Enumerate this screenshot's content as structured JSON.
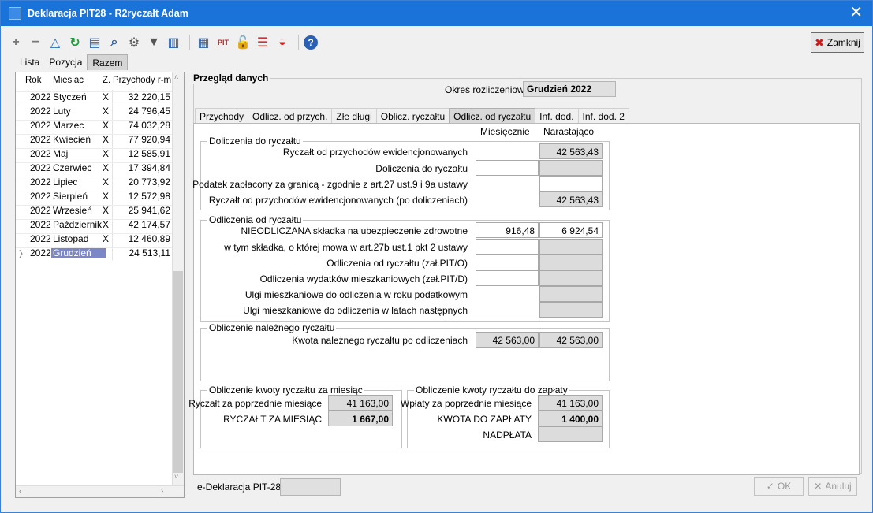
{
  "window": {
    "title": "Deklaracja PIT28 - R2ryczałt Adam"
  },
  "toolbar": {
    "icons": [
      "plus-icon",
      "minus-icon",
      "triangle-icon",
      "refresh-icon",
      "print-icon",
      "search-icon",
      "settings-icon",
      "filter-icon",
      "columns-icon",
      "grid-icon",
      "pit-icon",
      "unlock-icon",
      "stack-icon",
      "send-icon",
      "help-icon"
    ],
    "close_label": "Zamknij"
  },
  "subtabs": [
    {
      "label": "Lista"
    },
    {
      "label": "Pozycja"
    },
    {
      "label": "Razem"
    }
  ],
  "list": {
    "headers": {
      "rok": "Rok",
      "miesiac": "Miesiac",
      "z": "Z.",
      "przychody": "Przychody r-m"
    },
    "rows": [
      {
        "rok": "2022",
        "miesiac": "Styczeń",
        "z": "X",
        "przychody": "32 220,15"
      },
      {
        "rok": "2022",
        "miesiac": "Luty",
        "z": "X",
        "przychody": "24 796,45"
      },
      {
        "rok": "2022",
        "miesiac": "Marzec",
        "z": "X",
        "przychody": "74 032,28"
      },
      {
        "rok": "2022",
        "miesiac": "Kwiecień",
        "z": "X",
        "przychody": "77 920,94"
      },
      {
        "rok": "2022",
        "miesiac": "Maj",
        "z": "X",
        "przychody": "12 585,91"
      },
      {
        "rok": "2022",
        "miesiac": "Czerwiec",
        "z": "X",
        "przychody": "17 394,84"
      },
      {
        "rok": "2022",
        "miesiac": "Lipiec",
        "z": "X",
        "przychody": "20 773,92"
      },
      {
        "rok": "2022",
        "miesiac": "Sierpień",
        "z": "X",
        "przychody": "12 572,98"
      },
      {
        "rok": "2022",
        "miesiac": "Wrzesień",
        "z": "X",
        "przychody": "25 941,62"
      },
      {
        "rok": "2022",
        "miesiac": "Październik",
        "z": "X",
        "przychody": "42 174,57"
      },
      {
        "rok": "2022",
        "miesiac": "Listopad",
        "z": "X",
        "przychody": "12 460,89"
      },
      {
        "rok": "2022",
        "miesiac": "Grudzień",
        "z": "",
        "przychody": "24 513,11"
      }
    ]
  },
  "main": {
    "group_title": "Przegląd danych",
    "okres_label": "Okres rozliczeniowy",
    "okres_value": "Grudzień 2022",
    "tabs": [
      {
        "label": "Przychody"
      },
      {
        "label": "Odlicz. od przych."
      },
      {
        "label": "Złe długi"
      },
      {
        "label": "Oblicz. ryczałtu"
      },
      {
        "label": "Odlicz. od ryczałtu"
      },
      {
        "label": "Inf. dod."
      },
      {
        "label": "Inf. dod. 2"
      }
    ],
    "col_monthly": "Miesięcznie",
    "col_cumulative": "Narastająco",
    "sec1": {
      "title": "Doliczenia do ryczałtu",
      "r1_label": "Ryczałt od przychodów ewidencjonowanych",
      "r1_cum": "42 563,43",
      "r2_label": "Doliczenia do ryczałtu",
      "r3_label": "Podatek zapłacony za granicą - zgodnie z art.27 ust.9 i 9a ustawy",
      "r4_label": "Ryczałt od przychodów ewidencjonowanych (po doliczeniach)",
      "r4_cum": "42 563,43"
    },
    "sec2": {
      "title": "Odliczenia od ryczałtu",
      "r1_label": "NIEODLICZANA składka na ubezpieczenie zdrowotne",
      "r1_mon": "916,48",
      "r1_cum": "6 924,54",
      "r2_label": "w tym składka, o której mowa w art.27b ust.1 pkt 2 ustawy",
      "r3_label": "Odliczenia od ryczałtu (zał.PIT/O)",
      "r4_label": "Odliczenia wydatków mieszkaniowych (zał.PIT/D)",
      "r5_label": "Ulgi mieszkaniowe do odliczenia w roku podatkowym",
      "r6_label": "Ulgi mieszkaniowe do odliczenia w latach następnych"
    },
    "sec3": {
      "title": "Obliczenie należnego ryczałtu",
      "r1_label": "Kwota należnego ryczałtu po odliczeniach",
      "r1_mon": "42 563,00",
      "r1_cum": "42 563,00"
    },
    "sec4": {
      "title": "Obliczenie kwoty ryczałtu za miesiąc",
      "r1_label": "Ryczałt za poprzednie miesiące",
      "r1_val": "41 163,00",
      "r2_label": "RYCZAŁT ZA MIESIĄC",
      "r2_val": "1 667,00"
    },
    "sec5": {
      "title": "Obliczenie kwoty ryczałtu do zapłaty",
      "r1_label": "Wpłaty za poprzednie miesiące",
      "r1_val": "41 163,00",
      "r2_label": "KWOTA DO ZAPŁATY",
      "r2_val": "1 400,00",
      "r3_label": "NADPŁATA"
    }
  },
  "footer": {
    "edekl_label": "e-Deklaracja PIT-28",
    "ok_label": "OK",
    "cancel_label": "Anuluj"
  }
}
